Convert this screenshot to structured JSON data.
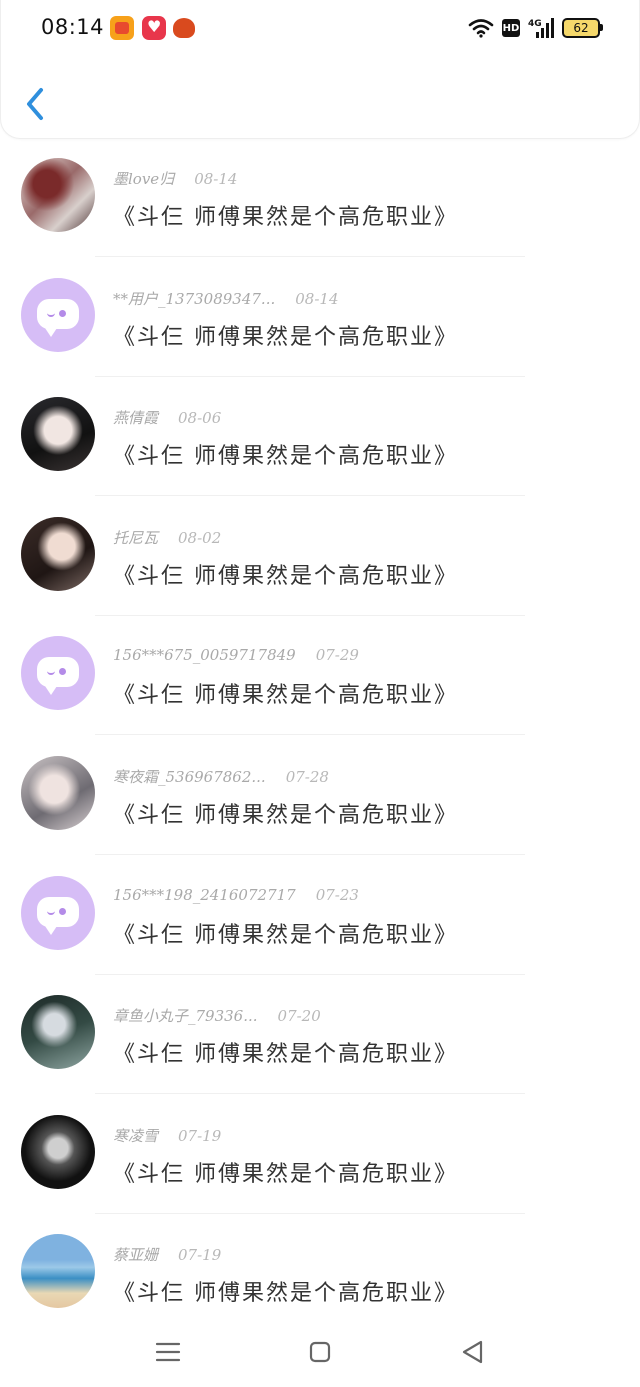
{
  "status_bar": {
    "time": "08:14",
    "network": "HD",
    "signal": "4G",
    "battery": "62"
  },
  "colors": {
    "accent": "#2f8fdd",
    "default_avatar": "#d6bdf6",
    "meta_text": "#a9a9a9"
  },
  "comments": [
    {
      "user": "墨love归",
      "date": "08-14",
      "text": "《斗仨  师傅果然是个高危职业》",
      "avatar": "photo"
    },
    {
      "user": "**用户_1373089347...",
      "date": "08-14",
      "text": "《斗仨  师傅果然是个高危职业》",
      "avatar": "default"
    },
    {
      "user": "燕倩霞",
      "date": "08-06",
      "text": "《斗仨  师傅果然是个高危职业》",
      "avatar": "photo"
    },
    {
      "user": "托尼瓦",
      "date": "08-02",
      "text": "《斗仨  师傅果然是个高危职业》",
      "avatar": "photo"
    },
    {
      "user": "156***675_0059717849",
      "date": "07-29",
      "text": "《斗仨  师傅果然是个高危职业》",
      "avatar": "default"
    },
    {
      "user": "寒夜霜_536967862...",
      "date": "07-28",
      "text": "《斗仨  师傅果然是个高危职业》",
      "avatar": "photo"
    },
    {
      "user": "156***198_2416072717",
      "date": "07-23",
      "text": "《斗仨  师傅果然是个高危职业》",
      "avatar": "default"
    },
    {
      "user": "章鱼小丸子_79336...",
      "date": "07-20",
      "text": "《斗仨  师傅果然是个高危职业》",
      "avatar": "photo"
    },
    {
      "user": "寒凌雪",
      "date": "07-19",
      "text": "《斗仨  师傅果然是个高危职业》",
      "avatar": "photo"
    },
    {
      "user": "蔡亚姗",
      "date": "07-19",
      "text": "《斗仨  师傅果然是个高危职业》",
      "avatar": "photo"
    }
  ]
}
